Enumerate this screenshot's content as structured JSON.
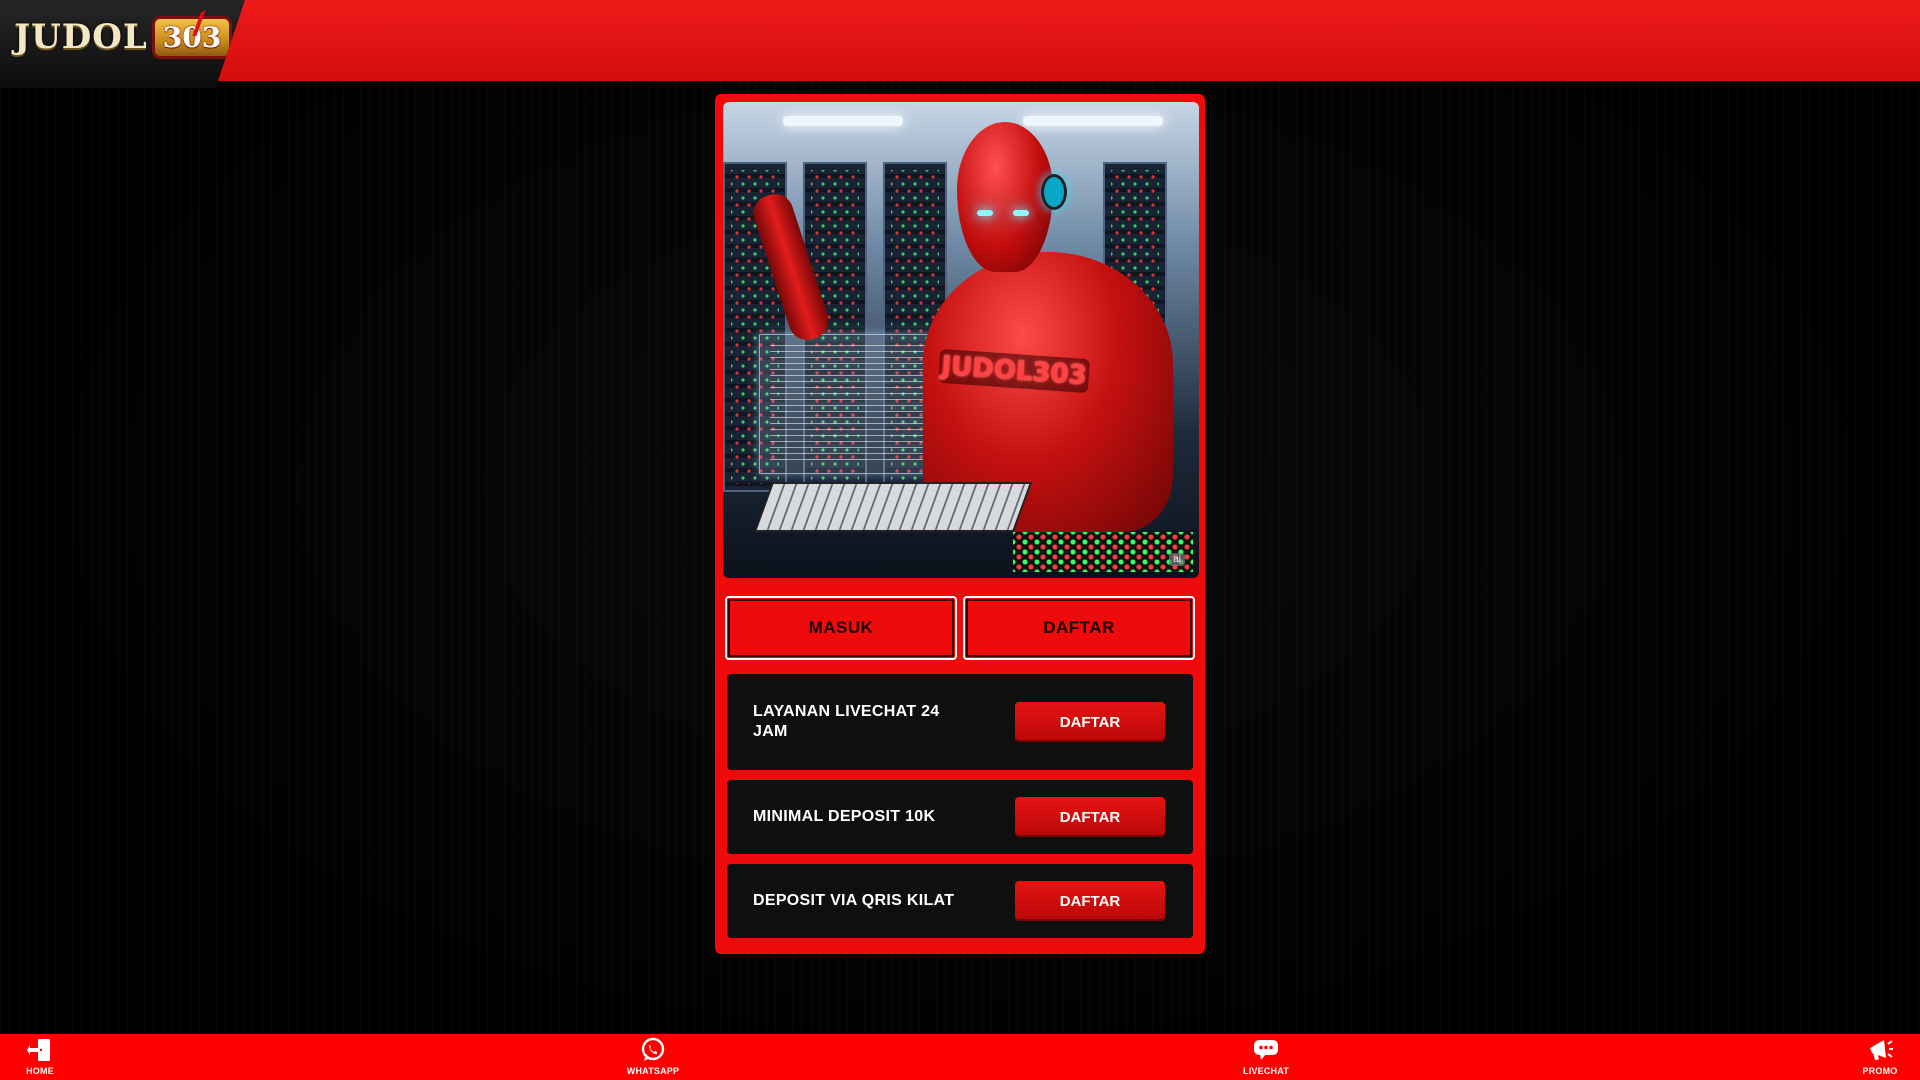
{
  "header": {
    "logo_text": "JUDOL",
    "logo_number": "303"
  },
  "hero": {
    "chest_label": "JUDOL303",
    "ai_tag": "ai"
  },
  "auth": {
    "login_label": "MASUK",
    "register_label": "DAFTAR"
  },
  "features": [
    {
      "label": "LAYANAN LIVECHAT 24 JAM",
      "button": "DAFTAR"
    },
    {
      "label": "MINIMAL DEPOSIT 10K",
      "button": "DAFTAR"
    },
    {
      "label": "DEPOSIT VIA QRIS KILAT",
      "button": "DAFTAR"
    }
  ],
  "bottom_nav": [
    {
      "label": "HOME",
      "icon": "home-door-icon"
    },
    {
      "label": "WHATSAPP",
      "icon": "whatsapp-icon"
    },
    {
      "label": "LIVECHAT",
      "icon": "chat-bubble-icon"
    },
    {
      "label": "PROMO",
      "icon": "megaphone-icon"
    }
  ],
  "colors": {
    "brand_red": "#ef0b0b",
    "header_red": "#e31414",
    "nav_red": "#ff0000",
    "background": "#000000",
    "feature_bg": "#0f0f0f"
  }
}
